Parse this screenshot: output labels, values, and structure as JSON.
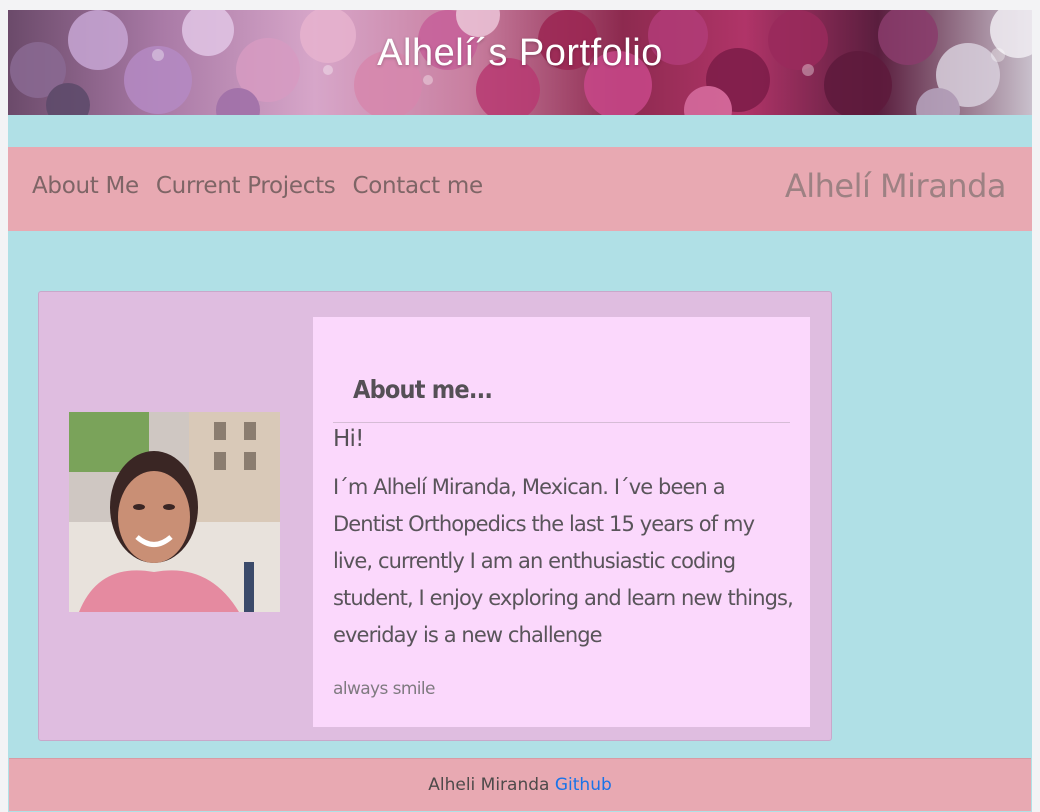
{
  "banner": {
    "title": "Alhelí´s Portfolio"
  },
  "nav": {
    "links": [
      "About Me",
      "Current Projects",
      "Contact me"
    ],
    "brand": "Alhelí Miranda"
  },
  "about": {
    "heading": "About me...",
    "greeting": "Hi!",
    "bio": "I´m Alhelí Miranda, Mexican. I´ve been a Dentist Orthopedics the last 15 years of my live, currently I am an enthusiastic coding student, I enjoy exploring and learn new things, everiday is a new challenge",
    "tagline": "always smile"
  },
  "footer": {
    "text": "Alheli Miranda",
    "link_label": "Github"
  },
  "colors": {
    "page_bg": "#b0e0e6",
    "nav_bg": "#e8a9b2",
    "card_bg": "#dfbde0",
    "content_bg": "#fbd8fc",
    "link": "#1a73e8"
  }
}
